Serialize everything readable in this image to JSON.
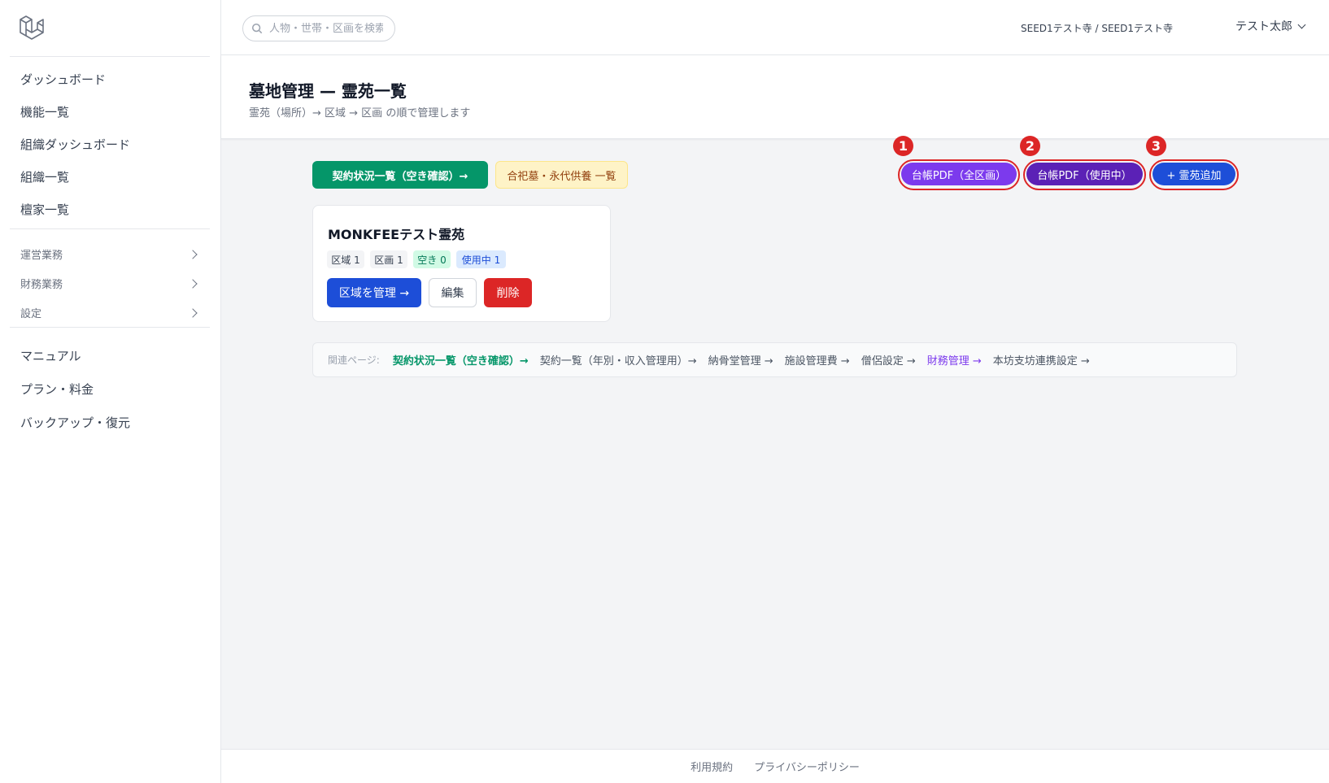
{
  "sidebar": {
    "nav": [
      {
        "label": "ダッシュボード"
      },
      {
        "label": "機能一覧"
      },
      {
        "label": "組織ダッシュボード"
      },
      {
        "label": "組織一覧"
      },
      {
        "label": "檀家一覧"
      }
    ],
    "groups": [
      {
        "label": "運営業務"
      },
      {
        "label": "財務業務"
      },
      {
        "label": "設定"
      }
    ],
    "extra": [
      {
        "label": "マニュアル"
      },
      {
        "label": "プラン・料金"
      },
      {
        "label": "バックアップ・復元"
      }
    ]
  },
  "topbar": {
    "search_placeholder": "人物・世帯・区画を検索",
    "org": "SEED1テスト寺 / SEED1テスト寺",
    "user": "テスト太郎"
  },
  "header": {
    "title": "墓地管理 — 霊苑一覧",
    "subtitle": "霊苑（場所）→ 区域 → 区画 の順で管理します"
  },
  "actions": {
    "contract_status": "契約状況一覧（空き確認）→",
    "memorial": "合祀墓・永代供養 一覧",
    "ledger_all": "台帳PDF（全区画）",
    "ledger_in_use": "台帳PDF（使用中）",
    "add_cemetery": "+ 霊苑追加"
  },
  "annotations": {
    "n1": "1",
    "n2": "2",
    "n3": "3"
  },
  "card": {
    "title": "MONKFEEテスト霊苑",
    "chips": {
      "area": "区域 1",
      "plot": "区画 1",
      "vacant": "空き 0",
      "in_use": "使用中 1"
    },
    "manage": "区域を管理 →",
    "edit": "編集",
    "delete": "削除"
  },
  "related": {
    "label": "関連ページ:",
    "links": [
      {
        "text": "契約状況一覧（空き確認）→"
      },
      {
        "text": "契約一覧（年別・収入管理用）→"
      },
      {
        "text": "納骨堂管理 →"
      },
      {
        "text": "施設管理費 →"
      },
      {
        "text": "僧侶設定 →"
      },
      {
        "text": "財務管理 →"
      },
      {
        "text": "本坊支坊連携設定 →"
      }
    ]
  },
  "footer": {
    "terms": "利用規約",
    "privacy": "プライバシーポリシー"
  },
  "colors": {
    "green": "#059669",
    "purple": "#7c3aed",
    "indigo": "#5b21b6",
    "blue": "#1d4ed8",
    "red": "#dc2626"
  }
}
